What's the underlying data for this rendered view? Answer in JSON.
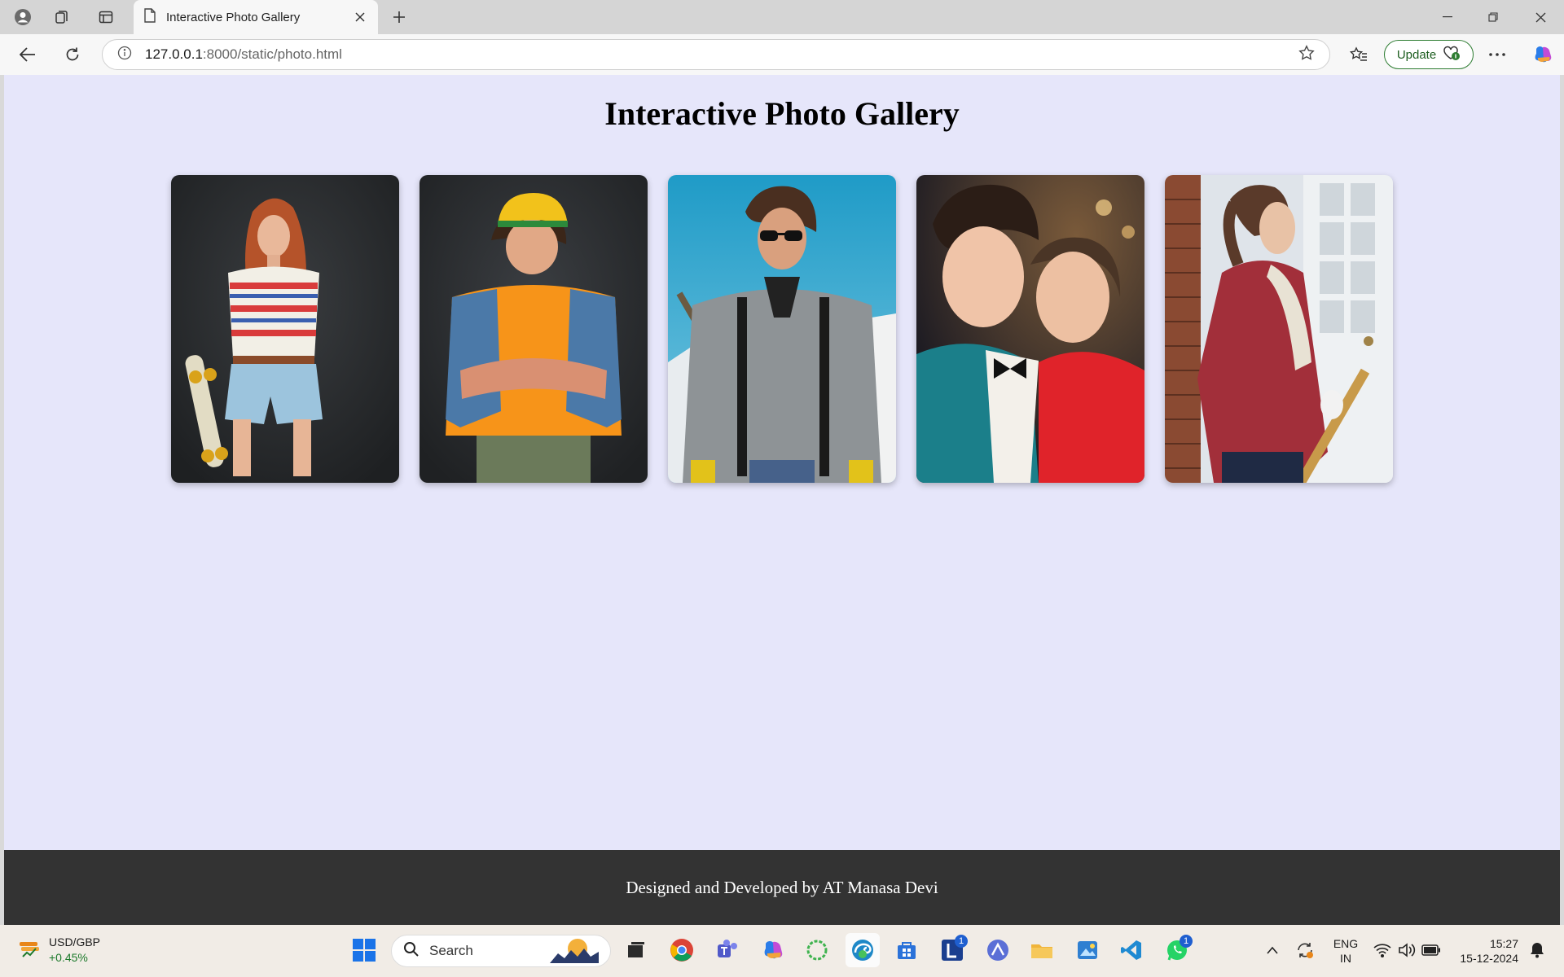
{
  "browser": {
    "tab_title": "Interactive Photo Gallery",
    "url_host": "127.0.0.1",
    "url_rest": ":8000/static/photo.html",
    "update_label": "Update"
  },
  "page": {
    "title": "Interactive Photo Gallery",
    "photos": [
      {
        "subject": "girl-with-skateboard"
      },
      {
        "subject": "boy-in-cap"
      },
      {
        "subject": "man-with-sunglasses"
      },
      {
        "subject": "two-kids-smiling"
      },
      {
        "subject": "girl-in-red-jacket"
      }
    ],
    "footer": "Designed and Developed by AT Manasa Devi"
  },
  "taskbar": {
    "ticker_pair": "USD/GBP",
    "ticker_change": "+0.45%",
    "search_label": "Search",
    "lang_1": "ENG",
    "lang_2": "IN",
    "time": "15:27",
    "date": "15-12-2024",
    "badge_1": "1",
    "badge_2": "1"
  },
  "colors": {
    "page_bg": "#e6e6fa",
    "footer_bg": "#333333",
    "update_green": "#2e7d32"
  }
}
